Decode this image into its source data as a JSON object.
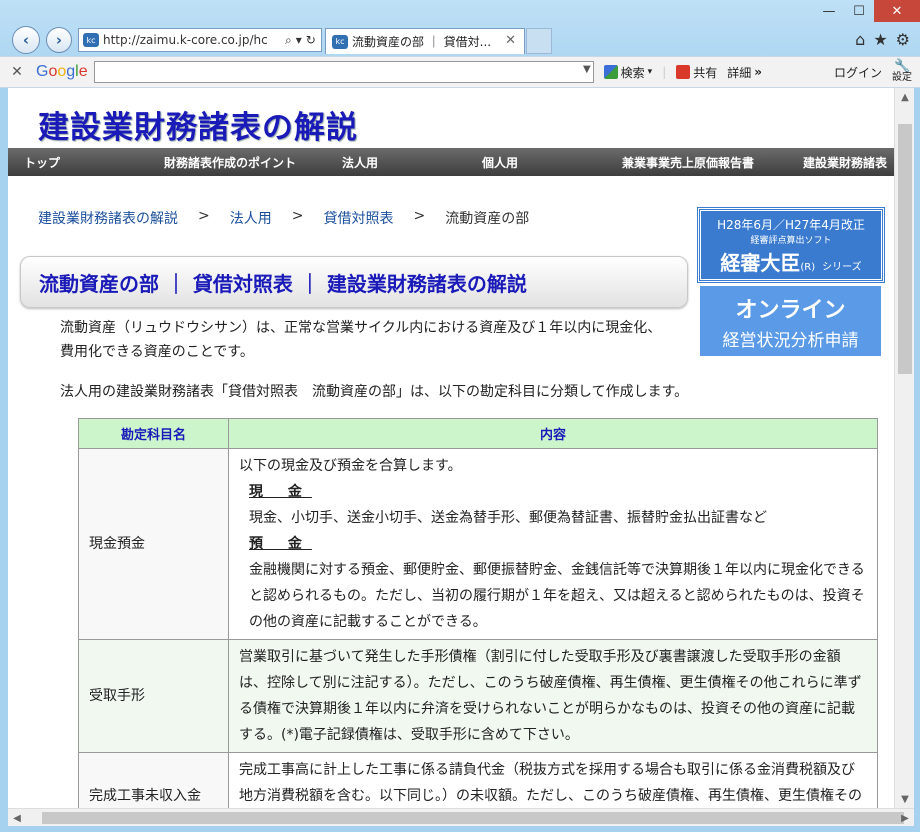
{
  "browser": {
    "back_icon": "back-arrow-icon",
    "forward_icon": "forward-arrow-icon",
    "address_url": "http://zaimu.k-core.co.jp/hc",
    "tab_title": "流動資産の部 ｜ 貸借対...",
    "tab_close": "✕",
    "win_minimize": "—",
    "win_maximize": "☐",
    "win_close": "✕"
  },
  "google_toolbar": {
    "close": "✕",
    "logo": "Google",
    "search_label": "検索",
    "share_label": "共有",
    "more_label": "詳細",
    "more_arrow": "»",
    "login_label": "ログイン",
    "settings_label": "設定"
  },
  "site": {
    "title": "建設業財務諸表の解説"
  },
  "nav": {
    "items": [
      "トップ",
      "財務諸表作成のポイント",
      "法人用",
      "個人用",
      "兼業事業売上原価報告書",
      "建設業財務諸表"
    ]
  },
  "breadcrumb": {
    "items": [
      "建設業財務諸表の解説",
      "法人用",
      "貸借対照表",
      "流動資産の部"
    ],
    "separator": ">"
  },
  "heading": "流動資産の部 ｜ 貸借対照表 ｜ 建設業財務諸表の解説",
  "intro": {
    "p1": "流動資産（リュウドウシサン）は、正常な営業サイクル内における資産及び１年以内に現金化、費用化できる資産のことです。",
    "p2": "法人用の建設業財務諸表「貸借対照表　流動資産の部」は、以下の勘定科目に分類して作成します。"
  },
  "banners": {
    "b1_line1": "H28年6月／H27年4月改正",
    "b1_line2": "経審評点算出ソフト",
    "b1_line3": "経審大臣",
    "b1_reg": "(R)",
    "b1_series": "シリーズ",
    "b2_line1": "オンライン",
    "b2_line2": "経営状況分析申請"
  },
  "table": {
    "headers": [
      "勘定科目名",
      "内容"
    ],
    "rows": [
      {
        "name": "現金預金",
        "intro": "以下の現金及び預金を合算します。",
        "sub1_title": "現 金",
        "sub1_text": "現金、小切手、送金小切手、送金為替手形、郵便為替証書、振替貯金払出証書など",
        "sub2_title": "預 金",
        "sub2_text": "金融機関に対する預金、郵便貯金、郵便振替貯金、金銭信託等で決算期後１年以内に現金化できると認められるもの。ただし、当初の履行期が１年を超え、又は超えると認められたものは、投資その他の資産に記載することができる。"
      },
      {
        "name": "受取手形",
        "text": "営業取引に基づいて発生した手形債権（割引に付した受取手形及び裏書譲渡した受取手形の金額は、控除して別に注記する）。ただし、このうち破産債権、再生債権、更生債権その他これらに準ずる債権で決算期後１年以内に弁済を受けられないことが明らかなものは、投資その他の資産に記載する。(*)電子記録債権は、受取手形に含めて下さい。"
      },
      {
        "name": "完成工事未収入金",
        "text": "完成工事高に計上した工事に係る請負代金（税抜方式を採用する場合も取引に係る金消費税額及び地方消費税額を含む。以下同じ。）の未収額。ただし、このうち破産債権、再生債権、更生債権その他これらに準ずる債権で決算期後１年以内に弁済を受けられない"
      }
    ]
  }
}
